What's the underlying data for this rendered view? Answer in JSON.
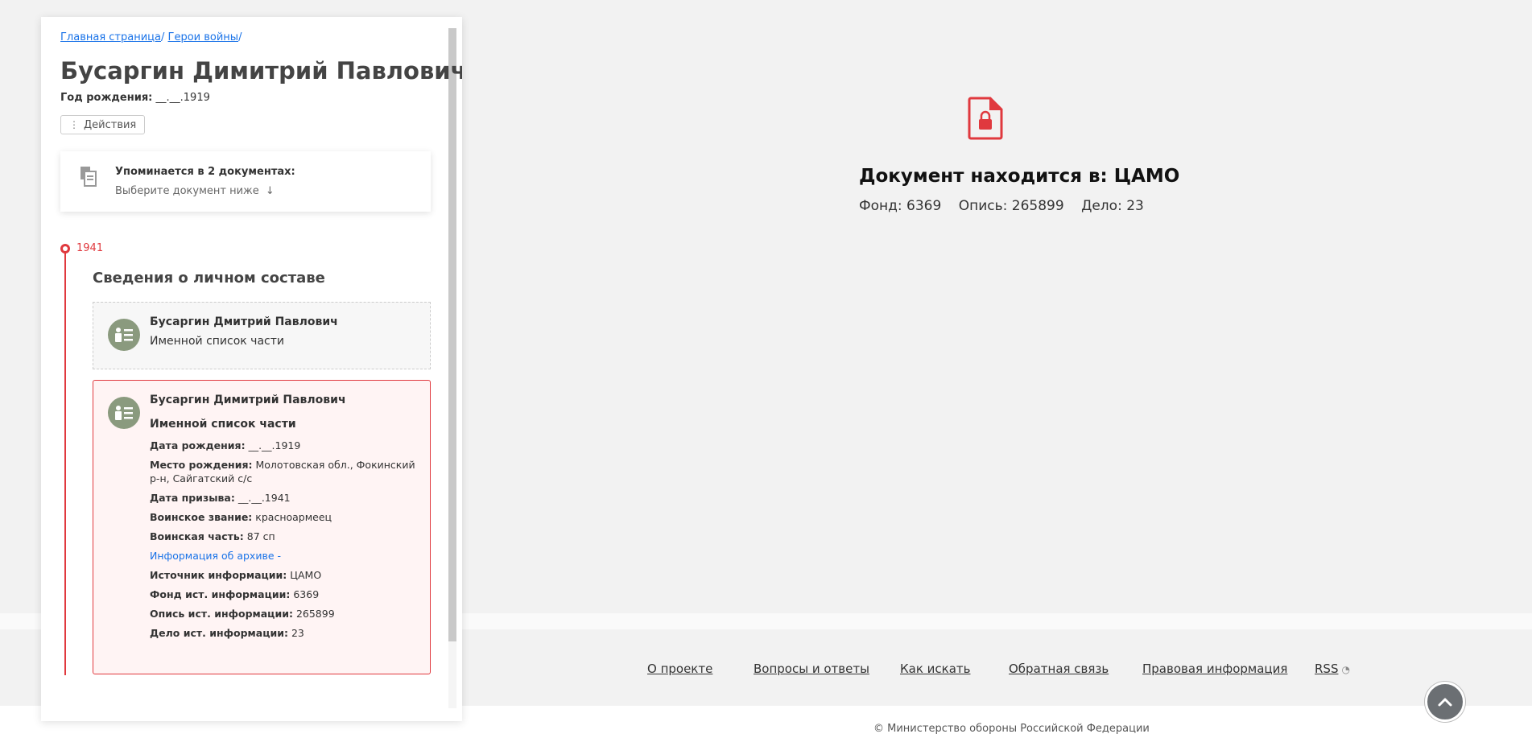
{
  "breadcrumb": {
    "items": [
      "Главная страница",
      "Герои войны"
    ],
    "separator": "/"
  },
  "person": {
    "name": "Бусаргин Димитрий Павлович",
    "birth_label": "Год рождения:",
    "birth_value": "__.__.1919"
  },
  "actions": {
    "label": "Действия",
    "icon": "vertical-dots-icon"
  },
  "mentions": {
    "title": "Упоминается в 2 документах:",
    "subtitle": "Выберите документ ниже",
    "arrow": "↓",
    "icon": "documents-icon"
  },
  "timeline": {
    "year": "1941",
    "section_title": "Сведения о личном составе",
    "accent_color": "#e0393e"
  },
  "records": [
    {
      "name": "Бусаргин Дмитрий Павлович",
      "type": "Именной список части"
    },
    {
      "name": "Бусаргин Димитрий Павлович",
      "type": "Именной список части",
      "fields": [
        {
          "label": "Дата рождения:",
          "value": "__.__.1919"
        },
        {
          "label": "Место рождения:",
          "value": "Молотовская обл., Фокинский р-н, Сайгатский с/с"
        },
        {
          "label": "Дата призыва:",
          "value": "__.__.1941"
        },
        {
          "label": "Воинское звание:",
          "value": "красноармеец"
        },
        {
          "label": "Воинская часть:",
          "value": "87 сп"
        }
      ],
      "archive_link": "Информация об архиве -",
      "archive_fields": [
        {
          "label": "Источник информации:",
          "value": "ЦАМО"
        },
        {
          "label": "Фонд ист. информации:",
          "value": "6369"
        },
        {
          "label": "Опись ист. информации:",
          "value": "265899"
        },
        {
          "label": "Дело ист. информации:",
          "value": "23"
        }
      ]
    }
  ],
  "document": {
    "title": "Документ находится в: ЦАМО",
    "fond": "Фонд: 6369",
    "opis": "Опись: 265899",
    "delo": "Дело: 23",
    "icon": "locked-document-icon",
    "icon_color": "#e0393e"
  },
  "footer": {
    "links": [
      "О проекте",
      "Вопросы и ответы",
      "Как искать",
      "Обратная связь",
      "Правовая информация",
      "RSS"
    ],
    "copyright": "© Министерство обороны Российской Федерации"
  }
}
